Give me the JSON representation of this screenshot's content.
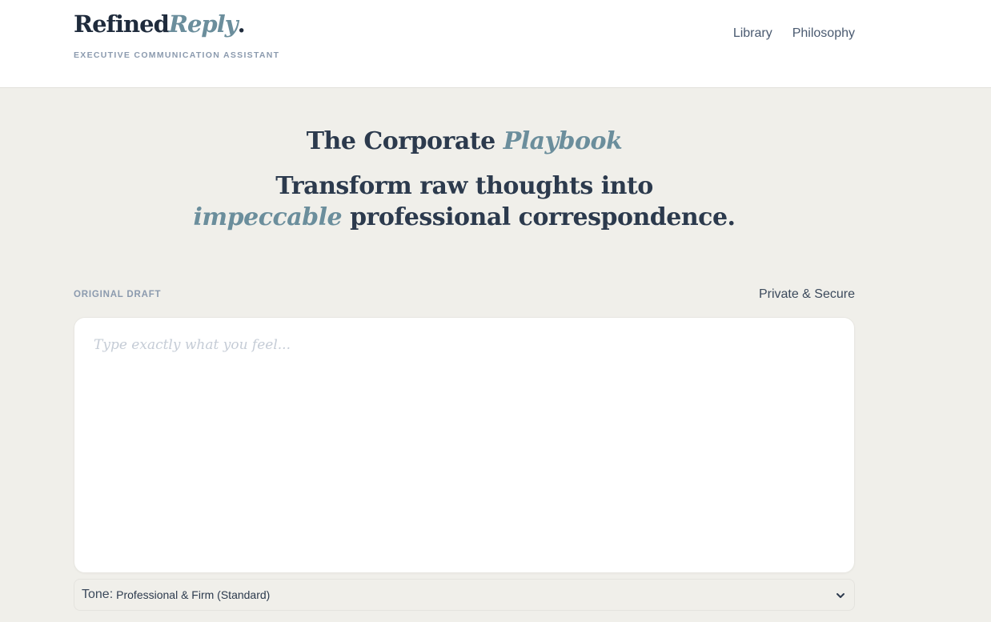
{
  "brand": {
    "name_main": "Refined",
    "name_accent": "Reply",
    "name_dot": ".",
    "tagline": "EXECUTIVE COMMUNICATION ASSISTANT"
  },
  "nav": {
    "items": [
      {
        "label": "Library"
      },
      {
        "label": "Philosophy"
      }
    ]
  },
  "hero": {
    "title_main": "The Corporate ",
    "title_accent": "Playbook",
    "sub_line1": "Transform raw thoughts into",
    "sub_accent": "impeccable",
    "sub_line2_rest": " professional correspondence."
  },
  "draft": {
    "label": "ORIGINAL DRAFT",
    "secure_text": "Private & Secure",
    "placeholder": "Type exactly what you feel...",
    "value": ""
  },
  "tone": {
    "label": "Tone:",
    "selected": "Professional & Firm (Standard)"
  },
  "colors": {
    "accent": "#6b8e9c",
    "ink": "#2c3a4d",
    "background": "#f0efea"
  }
}
